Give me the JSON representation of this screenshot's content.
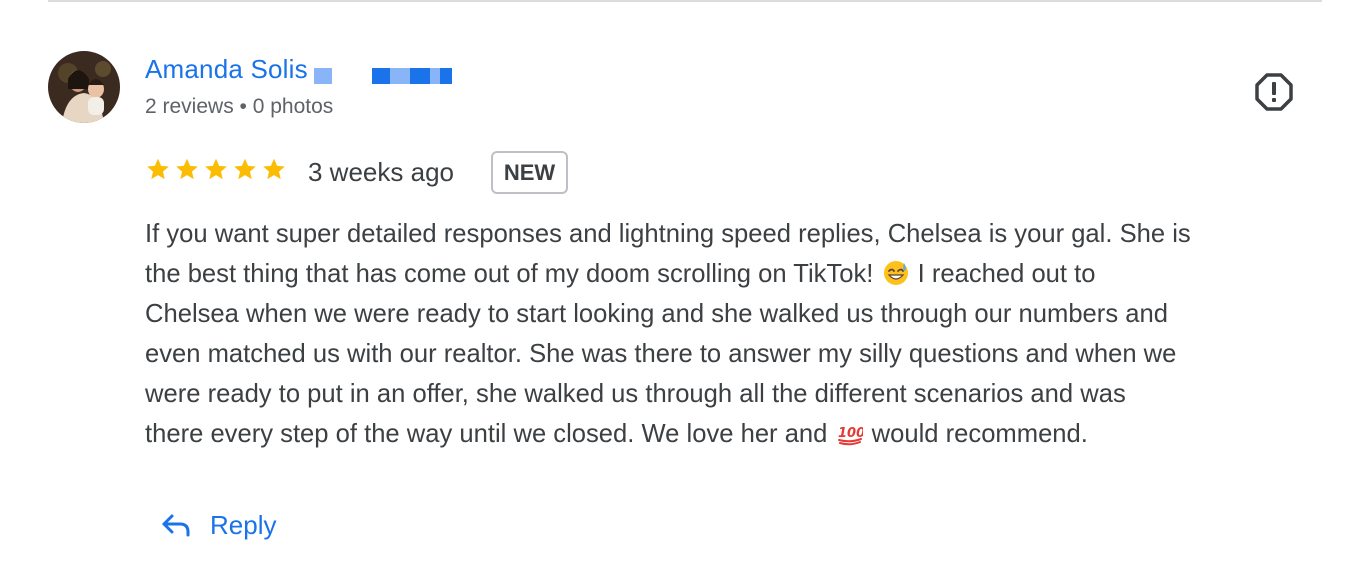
{
  "colors": {
    "link_blue": "#1a73e8",
    "star_gold": "#fbbc04",
    "text_primary": "#3c4043",
    "text_secondary": "#5f6368",
    "divider": "#dadce0"
  },
  "review": {
    "reviewer_name": "Amanda Solis",
    "reviewer_meta": "2 reviews • 0 photos",
    "rating": 5,
    "rating_max": 5,
    "date": "3 weeks ago",
    "badge": "NEW",
    "report_icon": "report-flag-icon",
    "body_lines": [
      "If you want super detailed responses and lightning speed replies, Chelsea is your gal. She is",
      "the best thing that has come out of my doom scrolling on TikTok!",
      "I reached out to",
      "Chelsea when we were ready to start looking and she walked us through our numbers and",
      "even matched us with our realtor. She was there to answer my silly questions and when we",
      "were ready to put in an offer, she walked us through all the different scenarios and was",
      "there every step of the way until we closed. We love her and",
      "would recommend."
    ],
    "emojis": [
      "grinning-sweat-emoji",
      "hundred-points-emoji"
    ]
  },
  "actions": {
    "reply_label": "Reply",
    "reply_icon": "reply-arrow-icon"
  }
}
